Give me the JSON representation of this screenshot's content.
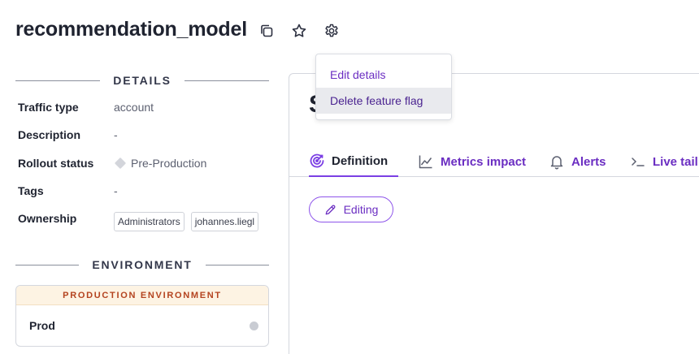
{
  "header": {
    "title": "recommendation_model",
    "icons": [
      "copy-icon",
      "star-icon",
      "gear-icon"
    ]
  },
  "details": {
    "heading": "DETAILS",
    "rows": [
      {
        "label": "Traffic type",
        "value": "account"
      },
      {
        "label": "Description",
        "value": "-"
      },
      {
        "label": "Rollout status",
        "value": "Pre-Production"
      },
      {
        "label": "Tags",
        "value": "-"
      },
      {
        "label": "Ownership",
        "chips": [
          "Administrators",
          "johannes.liegl"
        ]
      }
    ]
  },
  "environment": {
    "heading": "ENVIRONMENT",
    "banner": "PRODUCTION ENVIRONMENT",
    "name": "Prod"
  },
  "panel": {
    "heading_fragment": "S"
  },
  "tabs": [
    {
      "label": "Definition",
      "icon": "target-icon",
      "active": true
    },
    {
      "label": "Metrics impact",
      "icon": "line-chart-icon"
    },
    {
      "label": "Alerts",
      "icon": "bell-icon"
    },
    {
      "label": "Live tail",
      "icon": "terminal-icon"
    }
  ],
  "editing_button": {
    "label": "Editing",
    "icon": "pencil-icon"
  },
  "menu": {
    "items": [
      "Edit details",
      "Delete feature flag"
    ]
  },
  "colors": {
    "accent": "#6b2ec2",
    "banner_bg": "#fdf3e3",
    "banner_text": "#b4431f"
  }
}
